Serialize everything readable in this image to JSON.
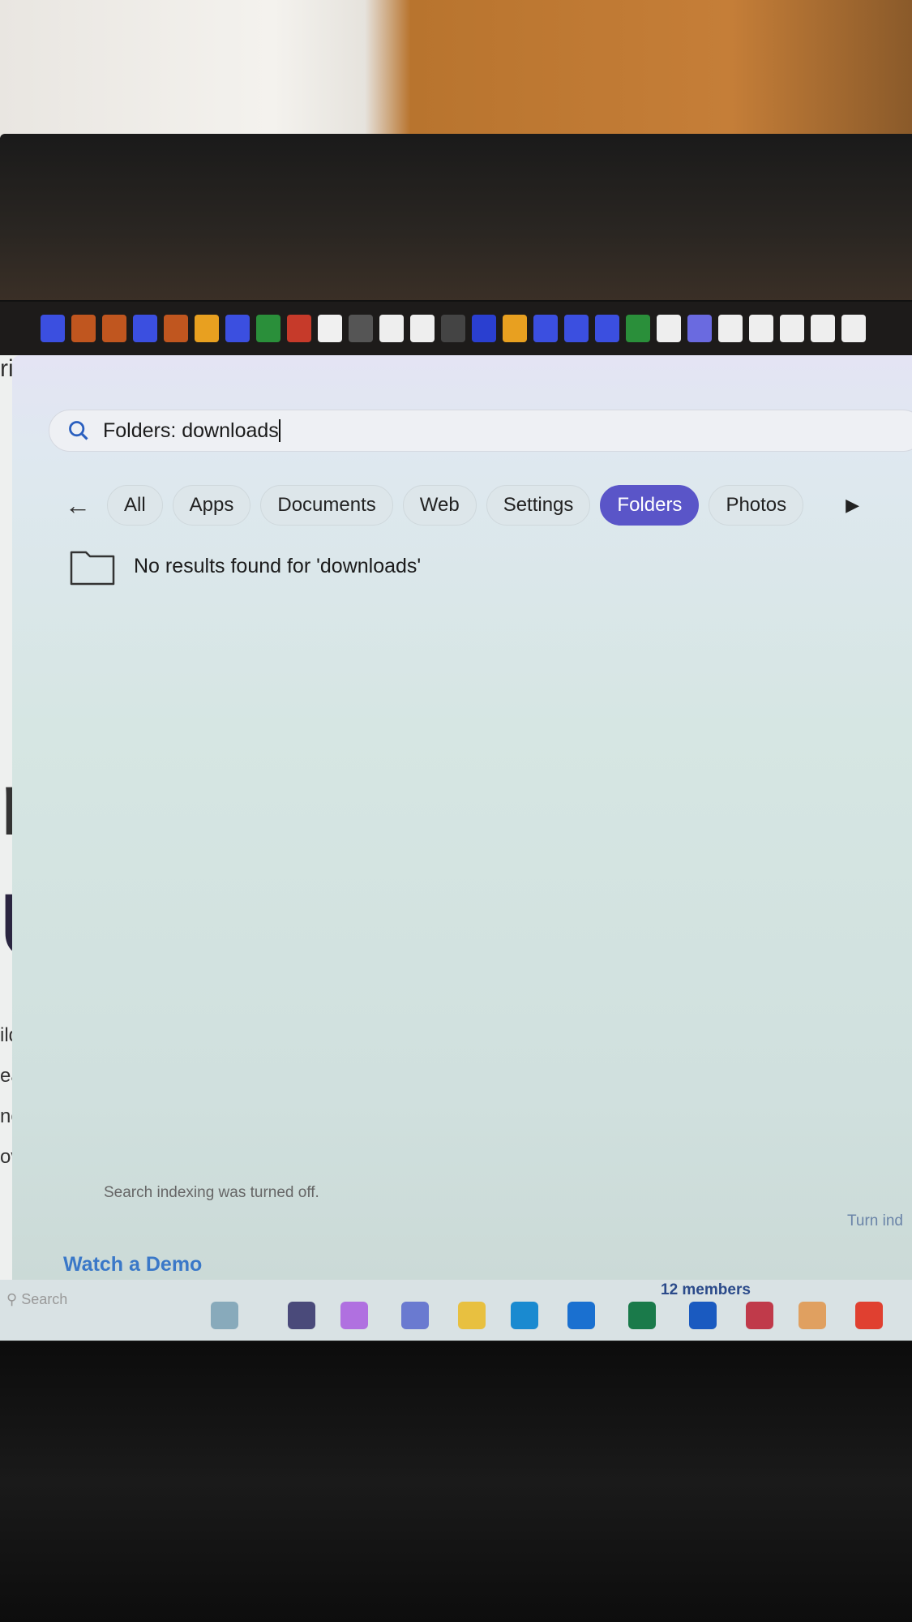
{
  "search": {
    "query": "Folders: downloads"
  },
  "filters": [
    {
      "label": "All",
      "active": false
    },
    {
      "label": "Apps",
      "active": false
    },
    {
      "label": "Documents",
      "active": false
    },
    {
      "label": "Web",
      "active": false
    },
    {
      "label": "Settings",
      "active": false
    },
    {
      "label": "Folders",
      "active": true
    },
    {
      "label": "Photos",
      "active": false
    }
  ],
  "result": {
    "message": "No results found for 'downloads'"
  },
  "footer": {
    "indexing_status": "Search indexing was turned off.",
    "turn_on_link": "Turn ind"
  },
  "background_page": {
    "fragments": [
      "ri",
      "r",
      "U",
      "ild c",
      "eal-t",
      "need",
      "oves"
    ],
    "watch_demo": "Watch a Demo",
    "members": "12 members"
  },
  "taskbar": {
    "search_placeholder": "Search"
  },
  "colors": {
    "accent": "#5a55c8"
  }
}
